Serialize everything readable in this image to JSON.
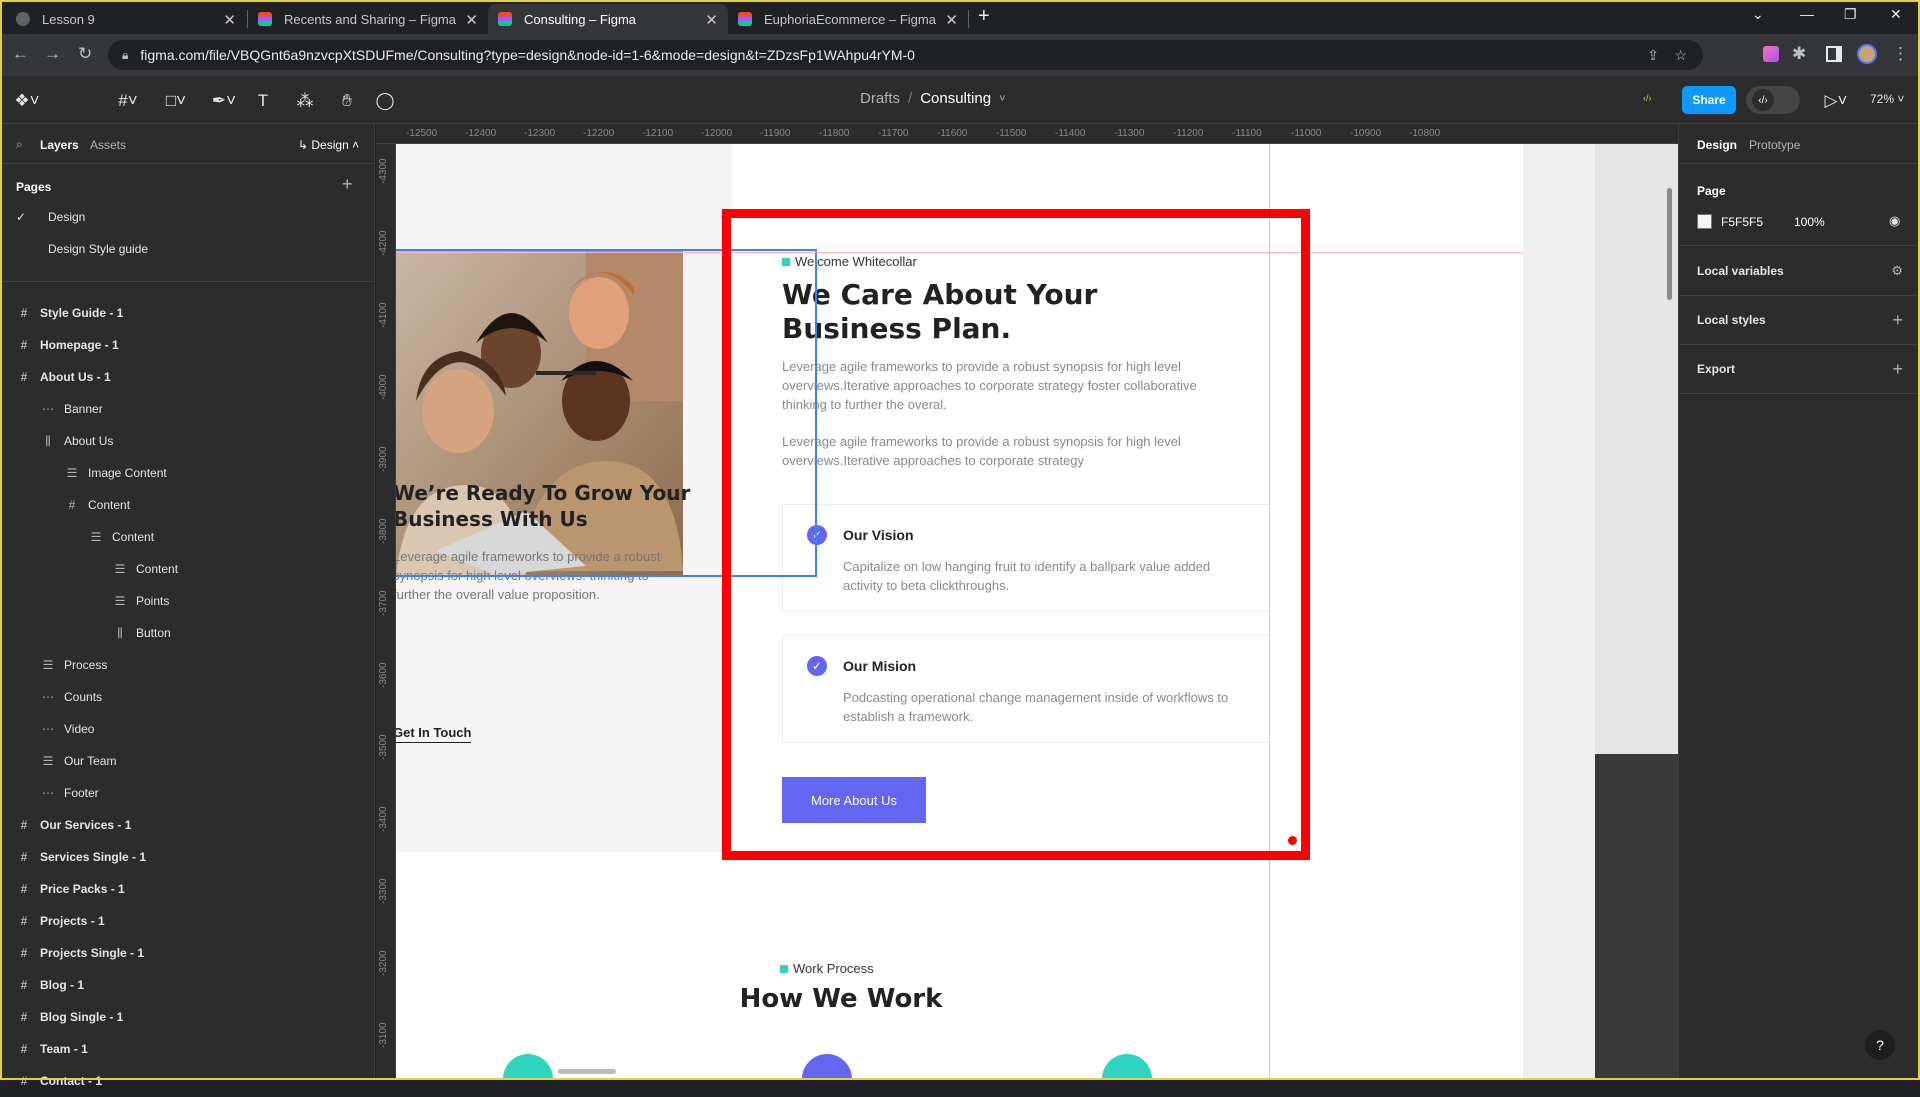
{
  "browser": {
    "tabs": [
      {
        "title": "Lesson 9",
        "active": false,
        "favicon": "globe-icon"
      },
      {
        "title": "Recents and Sharing – Figma",
        "active": false,
        "favicon": "figma-icon"
      },
      {
        "title": "Consulting – Figma",
        "active": true,
        "favicon": "figma-icon"
      },
      {
        "title": "EuphoriaEcommerce – Figma",
        "active": false,
        "favicon": "figma-icon"
      }
    ],
    "new_tab": "+",
    "url": "figma.com/file/VBQGnt6a9nzvcpXtSDUFme/Consulting?type=design&node-id=1-6&mode=design&t=ZDzsFp1WAhpu4rYM-0"
  },
  "figma": {
    "breadcrumb": {
      "parent": "Drafts",
      "separator": "/",
      "file": "Consulting"
    },
    "share_label": "Share",
    "zoom": "72%",
    "avatar_text": "‹/›",
    "left_tabs": {
      "layers": "Layers",
      "assets": "Assets",
      "page_switch": "Design"
    },
    "pages_header": "Pages",
    "pages": [
      {
        "name": "Design",
        "selected": true
      },
      {
        "name": "Design Style guide",
        "selected": false
      }
    ],
    "layers": [
      {
        "name": "Style Guide - 1",
        "indent": 0,
        "icon": "#",
        "bold": true
      },
      {
        "name": "Homepage - 1",
        "indent": 0,
        "icon": "#",
        "bold": true
      },
      {
        "name": "About Us - 1",
        "indent": 0,
        "icon": "#",
        "bold": true
      },
      {
        "name": "Banner",
        "indent": 1,
        "icon": "⋯",
        "bold": false
      },
      {
        "name": "About Us",
        "indent": 1,
        "icon": "⫼",
        "bold": false
      },
      {
        "name": "Image Content",
        "indent": 2,
        "icon": "☰",
        "bold": false
      },
      {
        "name": "Content",
        "indent": 2,
        "icon": "#",
        "bold": false
      },
      {
        "name": "Content",
        "indent": 3,
        "icon": "☰",
        "bold": false
      },
      {
        "name": "Content",
        "indent": 4,
        "icon": "☰",
        "bold": false
      },
      {
        "name": "Points",
        "indent": 4,
        "icon": "☰",
        "bold": false
      },
      {
        "name": "Button",
        "indent": 4,
        "icon": "⫼",
        "bold": false
      },
      {
        "name": "Process",
        "indent": 1,
        "icon": "☰",
        "bold": false
      },
      {
        "name": "Counts",
        "indent": 1,
        "icon": "⋯",
        "bold": false
      },
      {
        "name": "Video",
        "indent": 1,
        "icon": "⋯",
        "bold": false
      },
      {
        "name": "Our Team",
        "indent": 1,
        "icon": "☰",
        "bold": false
      },
      {
        "name": "Footer",
        "indent": 1,
        "icon": "⋯",
        "bold": false
      },
      {
        "name": "Our Services - 1",
        "indent": 0,
        "icon": "#",
        "bold": true
      },
      {
        "name": "Services Single - 1",
        "indent": 0,
        "icon": "#",
        "bold": true
      },
      {
        "name": "Price Packs - 1",
        "indent": 0,
        "icon": "#",
        "bold": true
      },
      {
        "name": "Projects - 1",
        "indent": 0,
        "icon": "#",
        "bold": true
      },
      {
        "name": "Projects Single - 1",
        "indent": 0,
        "icon": "#",
        "bold": true
      },
      {
        "name": "Blog - 1",
        "indent": 0,
        "icon": "#",
        "bold": true
      },
      {
        "name": "Blog Single - 1",
        "indent": 0,
        "icon": "#",
        "bold": true
      },
      {
        "name": "Team - 1",
        "indent": 0,
        "icon": "#",
        "bold": true
      },
      {
        "name": "Contact - 1",
        "indent": 0,
        "icon": "#",
        "bold": true
      }
    ],
    "h_ruler": [
      "-12500",
      "-12400",
      "-12300",
      "-12200",
      "-12100",
      "-12000",
      "-11900",
      "-11800",
      "-11700",
      "-11600",
      "-11500",
      "-11400",
      "-11300",
      "-11200",
      "-11100",
      "-11000",
      "-10900",
      "-10800"
    ],
    "v_ruler": [
      "-4300",
      "-4200",
      "-4100",
      "-4000",
      "-3900",
      "-3800",
      "-3700",
      "-3600",
      "-3500",
      "-3400",
      "-3300",
      "-3200",
      "-3100"
    ],
    "right_panel": {
      "tabs": {
        "design": "Design",
        "prototype": "Prototype"
      },
      "page_label": "Page",
      "page_color": "F5F5F5",
      "page_opacity": "100%",
      "sections": [
        "Local variables",
        "Local styles",
        "Export"
      ]
    },
    "help": "?"
  },
  "design": {
    "tagline": "Welcome Whitecollar",
    "heading_line1": "We Care About Your",
    "heading_line2": "Business Plan.",
    "para1": "Leverage agile frameworks to provide a robust synopsis for high level overviews.Iterative approaches to corporate strategy foster collaborative thinking to further the overal.",
    "para2": "Leverage agile frameworks to provide a robust synopsis for high level overviews.Iterative approaches to corporate strategy",
    "vision": {
      "title": "Our Vision",
      "text": "Capitalize on low hanging fruit to identify a ballpark value added activity to beta clickthroughs."
    },
    "mission": {
      "title": "Our Mision",
      "text": "Podcasting operational change management inside of workflows to establish a framework."
    },
    "button": "More About Us",
    "left_heading_line1": "We’re Ready To Grow Your",
    "left_heading_line2": "Business With Us",
    "left_para": "Leverage agile frameworks to provide a robust synopsis for high level overviews. thinking to further the overall value proposition.",
    "left_link": "Get In Touch",
    "process_tag": "Work Process",
    "process_heading": "How We Work",
    "accent": "#6366f1",
    "teal": "#2dd4bf",
    "highlight": "#ff0000"
  }
}
